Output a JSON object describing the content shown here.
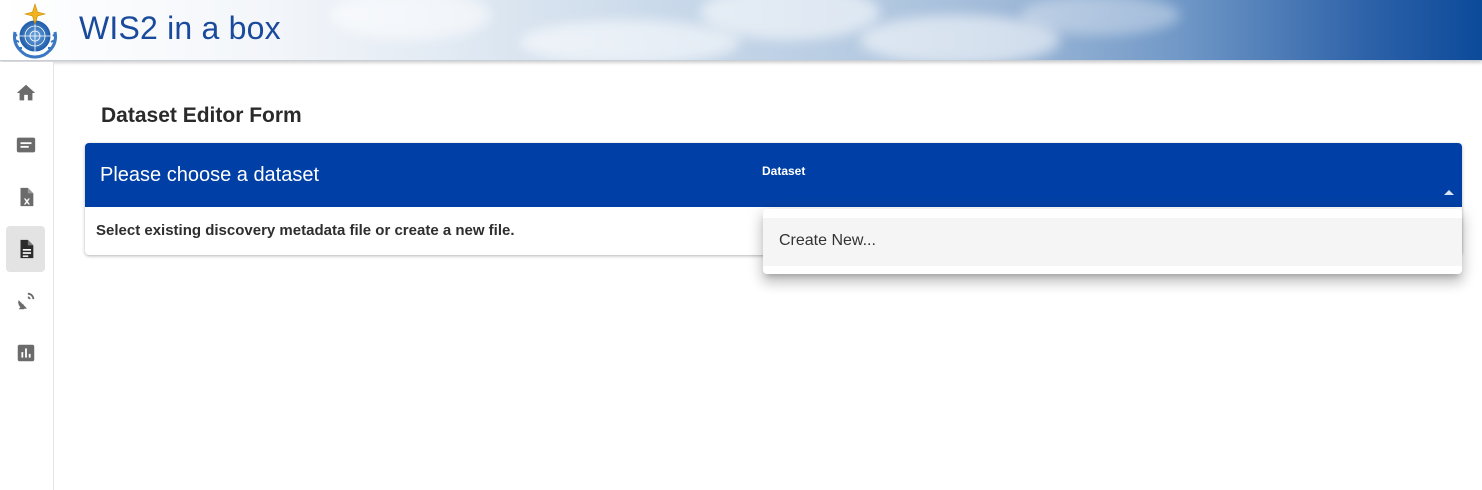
{
  "app": {
    "title": "WIS2 in a box"
  },
  "sidebar": {
    "items": [
      {
        "name": "home",
        "icon": "home-icon",
        "active": false
      },
      {
        "name": "messages",
        "icon": "message-icon",
        "active": false
      },
      {
        "name": "csv-data",
        "icon": "csv-file-icon",
        "active": false
      },
      {
        "name": "dataset-editor",
        "icon": "document-icon",
        "active": true
      },
      {
        "name": "stations",
        "icon": "satellite-dish-icon",
        "active": false
      },
      {
        "name": "monitoring",
        "icon": "bar-chart-icon",
        "active": false
      }
    ]
  },
  "main": {
    "page_title": "Dataset Editor Form",
    "card": {
      "header_title": "Please choose a dataset",
      "select_label": "Dataset",
      "body_text": "Select existing discovery metadata file or create a new file."
    },
    "dropdown": {
      "options": [
        "Create New..."
      ]
    }
  },
  "colors": {
    "brand_blue": "#0040a6",
    "title_blue": "#1a4a9c",
    "icon_grey": "#6b6b6b",
    "active_bg": "#e3e3e3"
  }
}
